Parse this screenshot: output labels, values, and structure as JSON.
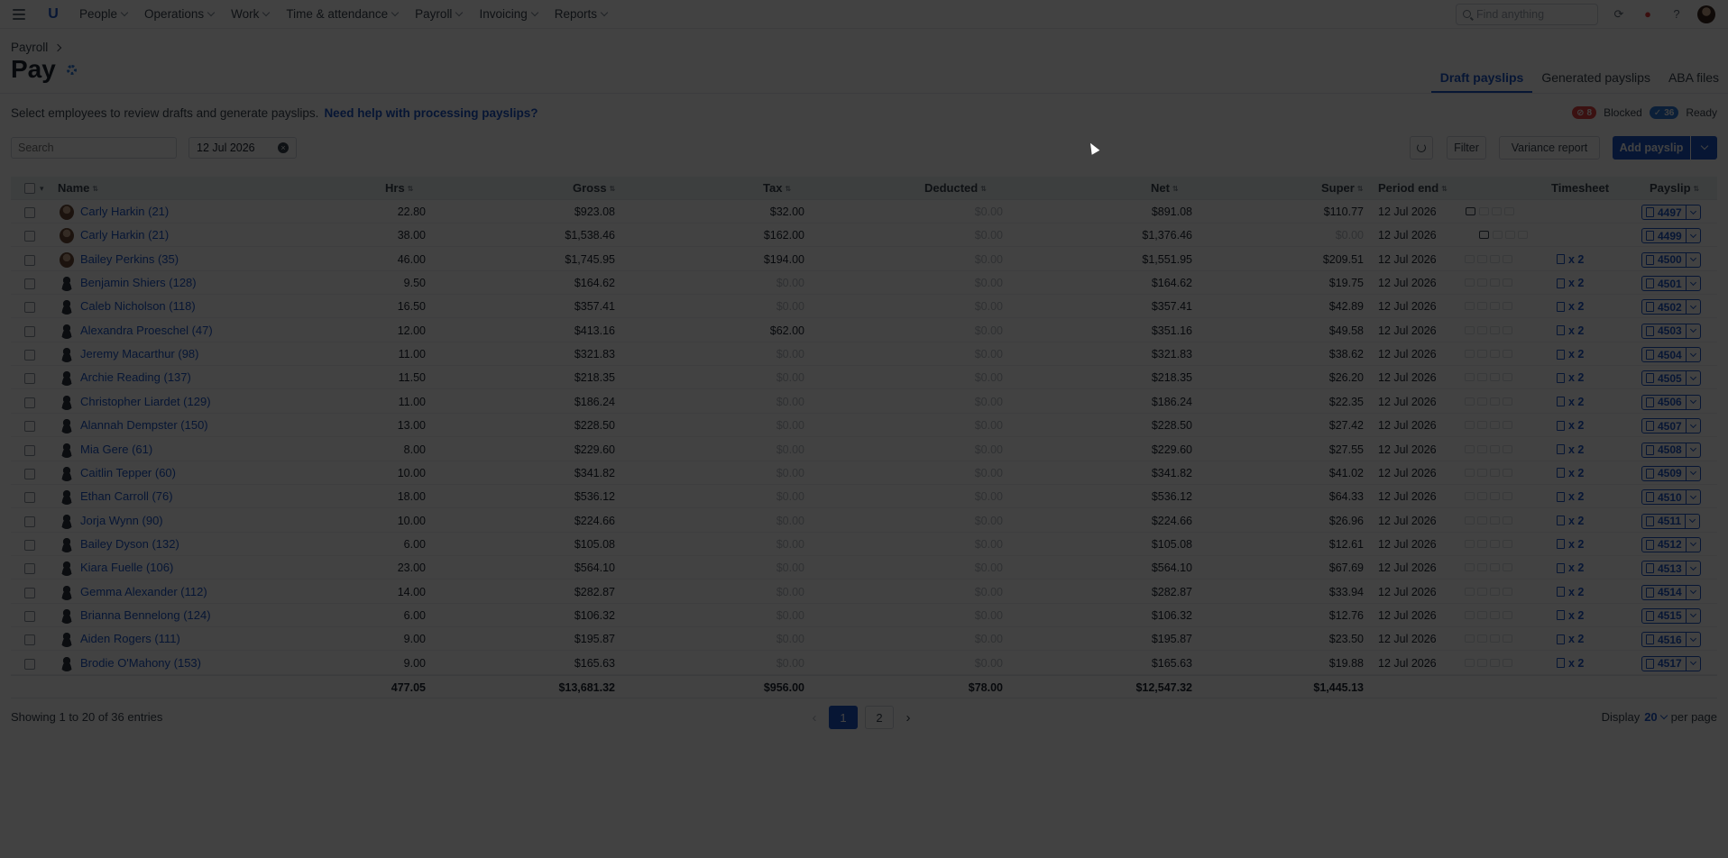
{
  "nav": {
    "items": [
      "People",
      "Operations",
      "Work",
      "Time & attendance",
      "Payroll",
      "Invoicing",
      "Reports"
    ],
    "find_placeholder": "Find anything"
  },
  "header": {
    "breadcrumb": "Payroll",
    "title": "Pay",
    "tabs": [
      "Draft payslips",
      "Generated payslips",
      "ABA files"
    ],
    "active_tab": "Draft payslips",
    "intro": "Select employees to review drafts and generate payslips.",
    "help_link": "Need help with processing payslips?",
    "blocked_count": "8",
    "blocked_label": "Blocked",
    "ready_count": "36",
    "ready_label": "Ready"
  },
  "toolbar": {
    "search_placeholder": "Search",
    "date": "12 Jul 2026",
    "filter_label": "Filter",
    "variance_label": "Variance report",
    "add_payslip_label": "Add payslip"
  },
  "table": {
    "columns": [
      "Name",
      "Hrs",
      "Gross",
      "Tax",
      "Deducted",
      "Net",
      "Super",
      "Period end",
      "Timesheet",
      "Payslip"
    ],
    "rows": [
      {
        "name": "Carly Harkin (21)",
        "hrs": "22.80",
        "gross": "$923.08",
        "tax": "$32.00",
        "deducted": "$0.00",
        "net": "$891.08",
        "super": "$110.77",
        "period_end": "12 Jul 2026",
        "timesheet": "",
        "payslip": "4497",
        "avatar": "photo",
        "comment": true
      },
      {
        "name": "Carly Harkin (21)",
        "hrs": "38.00",
        "gross": "$1,538.46",
        "tax": "$162.00",
        "deducted": "$0.00",
        "net": "$1,376.46",
        "super": "$0.00",
        "period_end": "12 Jul 2026",
        "timesheet": "",
        "payslip": "4499",
        "avatar": "photo",
        "comment": true
      },
      {
        "name": "Bailey Perkins (35)",
        "hrs": "46.00",
        "gross": "$1,745.95",
        "tax": "$194.00",
        "deducted": "$0.00",
        "net": "$1,551.95",
        "super": "$209.51",
        "period_end": "12 Jul 2026",
        "timesheet": "x 2",
        "payslip": "4500",
        "avatar": "photo",
        "comment": false
      },
      {
        "name": "Benjamin Shiers (128)",
        "hrs": "9.50",
        "gross": "$164.62",
        "tax": "$0.00",
        "deducted": "$0.00",
        "net": "$164.62",
        "super": "$19.75",
        "period_end": "12 Jul 2026",
        "timesheet": "x 2",
        "payslip": "4501",
        "avatar": "icon",
        "comment": false
      },
      {
        "name": "Caleb Nicholson (118)",
        "hrs": "16.50",
        "gross": "$357.41",
        "tax": "$0.00",
        "deducted": "$0.00",
        "net": "$357.41",
        "super": "$42.89",
        "period_end": "12 Jul 2026",
        "timesheet": "x 2",
        "payslip": "4502",
        "avatar": "icon",
        "comment": false
      },
      {
        "name": "Alexandra Proeschel (47)",
        "hrs": "12.00",
        "gross": "$413.16",
        "tax": "$62.00",
        "deducted": "$0.00",
        "net": "$351.16",
        "super": "$49.58",
        "period_end": "12 Jul 2026",
        "timesheet": "x 2",
        "payslip": "4503",
        "avatar": "icon",
        "comment": false
      },
      {
        "name": "Jeremy Macarthur (98)",
        "hrs": "11.00",
        "gross": "$321.83",
        "tax": "$0.00",
        "deducted": "$0.00",
        "net": "$321.83",
        "super": "$38.62",
        "period_end": "12 Jul 2026",
        "timesheet": "x 2",
        "payslip": "4504",
        "avatar": "icon",
        "comment": false
      },
      {
        "name": "Archie Reading (137)",
        "hrs": "11.50",
        "gross": "$218.35",
        "tax": "$0.00",
        "deducted": "$0.00",
        "net": "$218.35",
        "super": "$26.20",
        "period_end": "12 Jul 2026",
        "timesheet": "x 2",
        "payslip": "4505",
        "avatar": "icon",
        "comment": false
      },
      {
        "name": "Christopher Liardet (129)",
        "hrs": "11.00",
        "gross": "$186.24",
        "tax": "$0.00",
        "deducted": "$0.00",
        "net": "$186.24",
        "super": "$22.35",
        "period_end": "12 Jul 2026",
        "timesheet": "x 2",
        "payslip": "4506",
        "avatar": "icon",
        "comment": false
      },
      {
        "name": "Alannah Dempster (150)",
        "hrs": "13.00",
        "gross": "$228.50",
        "tax": "$0.00",
        "deducted": "$0.00",
        "net": "$228.50",
        "super": "$27.42",
        "period_end": "12 Jul 2026",
        "timesheet": "x 2",
        "payslip": "4507",
        "avatar": "icon",
        "comment": false
      },
      {
        "name": "Mia Gere (61)",
        "hrs": "8.00",
        "gross": "$229.60",
        "tax": "$0.00",
        "deducted": "$0.00",
        "net": "$229.60",
        "super": "$27.55",
        "period_end": "12 Jul 2026",
        "timesheet": "x 2",
        "payslip": "4508",
        "avatar": "icon",
        "comment": false
      },
      {
        "name": "Caitlin Tepper (60)",
        "hrs": "10.00",
        "gross": "$341.82",
        "tax": "$0.00",
        "deducted": "$0.00",
        "net": "$341.82",
        "super": "$41.02",
        "period_end": "12 Jul 2026",
        "timesheet": "x 2",
        "payslip": "4509",
        "avatar": "icon",
        "comment": false
      },
      {
        "name": "Ethan Carroll (76)",
        "hrs": "18.00",
        "gross": "$536.12",
        "tax": "$0.00",
        "deducted": "$0.00",
        "net": "$536.12",
        "super": "$64.33",
        "period_end": "12 Jul 2026",
        "timesheet": "x 2",
        "payslip": "4510",
        "avatar": "icon",
        "comment": false
      },
      {
        "name": "Jorja Wynn (90)",
        "hrs": "10.00",
        "gross": "$224.66",
        "tax": "$0.00",
        "deducted": "$0.00",
        "net": "$224.66",
        "super": "$26.96",
        "period_end": "12 Jul 2026",
        "timesheet": "x 2",
        "payslip": "4511",
        "avatar": "icon",
        "comment": false
      },
      {
        "name": "Bailey Dyson (132)",
        "hrs": "6.00",
        "gross": "$105.08",
        "tax": "$0.00",
        "deducted": "$0.00",
        "net": "$105.08",
        "super": "$12.61",
        "period_end": "12 Jul 2026",
        "timesheet": "x 2",
        "payslip": "4512",
        "avatar": "icon",
        "comment": false
      },
      {
        "name": "Kiara Fuelle (106)",
        "hrs": "23.00",
        "gross": "$564.10",
        "tax": "$0.00",
        "deducted": "$0.00",
        "net": "$564.10",
        "super": "$67.69",
        "period_end": "12 Jul 2026",
        "timesheet": "x 2",
        "payslip": "4513",
        "avatar": "icon",
        "comment": false
      },
      {
        "name": "Gemma Alexander (112)",
        "hrs": "14.00",
        "gross": "$282.87",
        "tax": "$0.00",
        "deducted": "$0.00",
        "net": "$282.87",
        "super": "$33.94",
        "period_end": "12 Jul 2026",
        "timesheet": "x 2",
        "payslip": "4514",
        "avatar": "icon",
        "comment": false
      },
      {
        "name": "Brianna Bennelong (124)",
        "hrs": "6.00",
        "gross": "$106.32",
        "tax": "$0.00",
        "deducted": "$0.00",
        "net": "$106.32",
        "super": "$12.76",
        "period_end": "12 Jul 2026",
        "timesheet": "x 2",
        "payslip": "4515",
        "avatar": "icon",
        "comment": false
      },
      {
        "name": "Aiden Rogers (111)",
        "hrs": "9.00",
        "gross": "$195.87",
        "tax": "$0.00",
        "deducted": "$0.00",
        "net": "$195.87",
        "super": "$23.50",
        "period_end": "12 Jul 2026",
        "timesheet": "x 2",
        "payslip": "4516",
        "avatar": "icon",
        "comment": false
      },
      {
        "name": "Brodie O'Mahony (153)",
        "hrs": "9.00",
        "gross": "$165.63",
        "tax": "$0.00",
        "deducted": "$0.00",
        "net": "$165.63",
        "super": "$19.88",
        "period_end": "12 Jul 2026",
        "timesheet": "x 2",
        "payslip": "4517",
        "avatar": "icon",
        "comment": false
      }
    ],
    "totals": {
      "hrs": "477.05",
      "gross": "$13,681.32",
      "tax": "$956.00",
      "deducted": "$78.00",
      "net": "$12,547.32",
      "super": "$1,445.13"
    }
  },
  "footer": {
    "showing": "Showing 1 to 20 of 36 entries",
    "pages": [
      "1",
      "2"
    ],
    "active_page": "1",
    "display_label": "Display",
    "per_page_value": "20",
    "per_page_label": "per page"
  },
  "colors": {
    "accent": "#1d56c9",
    "blocked": "#e44343",
    "ready": "#2d78d6",
    "overlay": "#000000"
  }
}
